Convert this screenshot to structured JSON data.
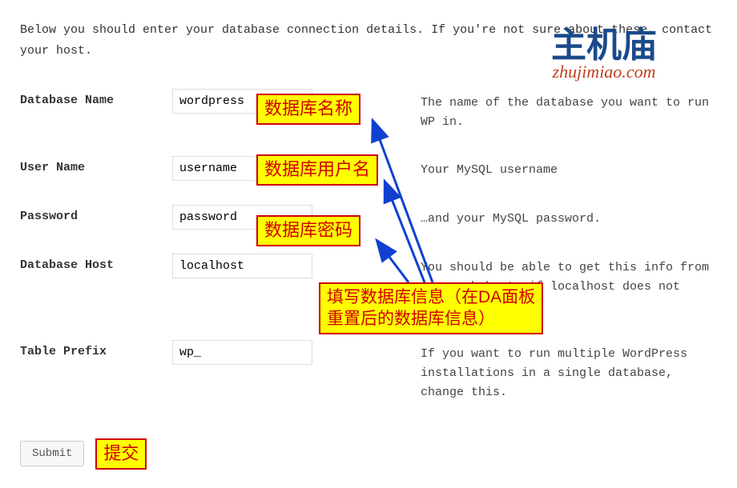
{
  "intro": "Below you should enter your database connection details. If you're not sure about these, contact your host.",
  "fields": {
    "db_name": {
      "label": "Database Name",
      "value": "wordpress",
      "desc": "The name of the database you want to run WP in."
    },
    "user_name": {
      "label": "User Name",
      "value": "username",
      "desc": "Your MySQL username"
    },
    "password": {
      "label": "Password",
      "value": "password",
      "desc": "…and your MySQL password."
    },
    "db_host": {
      "label": "Database Host",
      "value": "localhost",
      "desc": "You should be able to get this info from your web host, if localhost does not work."
    },
    "table_prefix": {
      "label": "Table Prefix",
      "value": "wp_",
      "desc": "If you want to run multiple WordPress installations in a single database, change this."
    }
  },
  "submit_label": "Submit",
  "annotations": {
    "db_name": "数据库名称",
    "user_name": "数据库用户名",
    "password": "数据库密码",
    "fill_info_line1": "填写数据库信息（在DA面板",
    "fill_info_line2": "重置后的数据库信息）",
    "submit": "提交"
  },
  "watermark": {
    "cn": "主机庙",
    "en": "zhujimiao.com"
  }
}
